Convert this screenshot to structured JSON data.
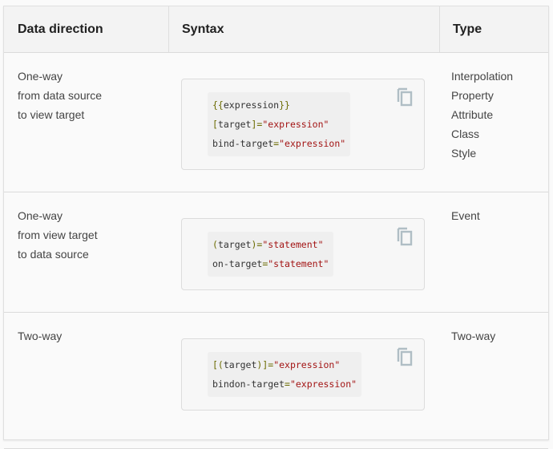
{
  "headers": [
    "Data direction",
    "Syntax",
    "Type"
  ],
  "rows": [
    {
      "direction": [
        "One-way",
        "from data source",
        "to view target"
      ],
      "code": [
        [
          {
            "t": "{{",
            "c": "p"
          },
          {
            "t": "expression",
            "c": ""
          },
          {
            "t": "}}",
            "c": "p"
          }
        ],
        [
          {
            "t": "[",
            "c": "p"
          },
          {
            "t": "target",
            "c": ""
          },
          {
            "t": "]=",
            "c": "p"
          },
          {
            "t": "\"expression\"",
            "c": "s"
          }
        ],
        [
          {
            "t": "bind-target",
            "c": ""
          },
          {
            "t": "=",
            "c": "p"
          },
          {
            "t": "\"expression\"",
            "c": "s"
          }
        ]
      ],
      "types": [
        "Interpolation",
        "Property",
        "Attribute",
        "Class",
        "Style"
      ]
    },
    {
      "direction": [
        "One-way",
        "from view target",
        "to data source"
      ],
      "code": [
        [
          {
            "t": "(",
            "c": "p"
          },
          {
            "t": "target",
            "c": ""
          },
          {
            "t": ")=",
            "c": "p"
          },
          {
            "t": "\"statement\"",
            "c": "s"
          }
        ],
        [
          {
            "t": "on-target",
            "c": ""
          },
          {
            "t": "=",
            "c": "p"
          },
          {
            "t": "\"statement\"",
            "c": "s"
          }
        ]
      ],
      "types": [
        "Event"
      ]
    },
    {
      "direction": [
        "Two-way"
      ],
      "code": [
        [
          {
            "t": "[(",
            "c": "p"
          },
          {
            "t": "target",
            "c": ""
          },
          {
            "t": ")]=",
            "c": "p"
          },
          {
            "t": "\"expression\"",
            "c": "s"
          }
        ],
        [
          {
            "t": "bindon-target",
            "c": ""
          },
          {
            "t": "=",
            "c": "p"
          },
          {
            "t": "\"expression\"",
            "c": "s"
          }
        ]
      ],
      "types": [
        "Two-way"
      ]
    }
  ],
  "copy_icon": "copy-icon"
}
